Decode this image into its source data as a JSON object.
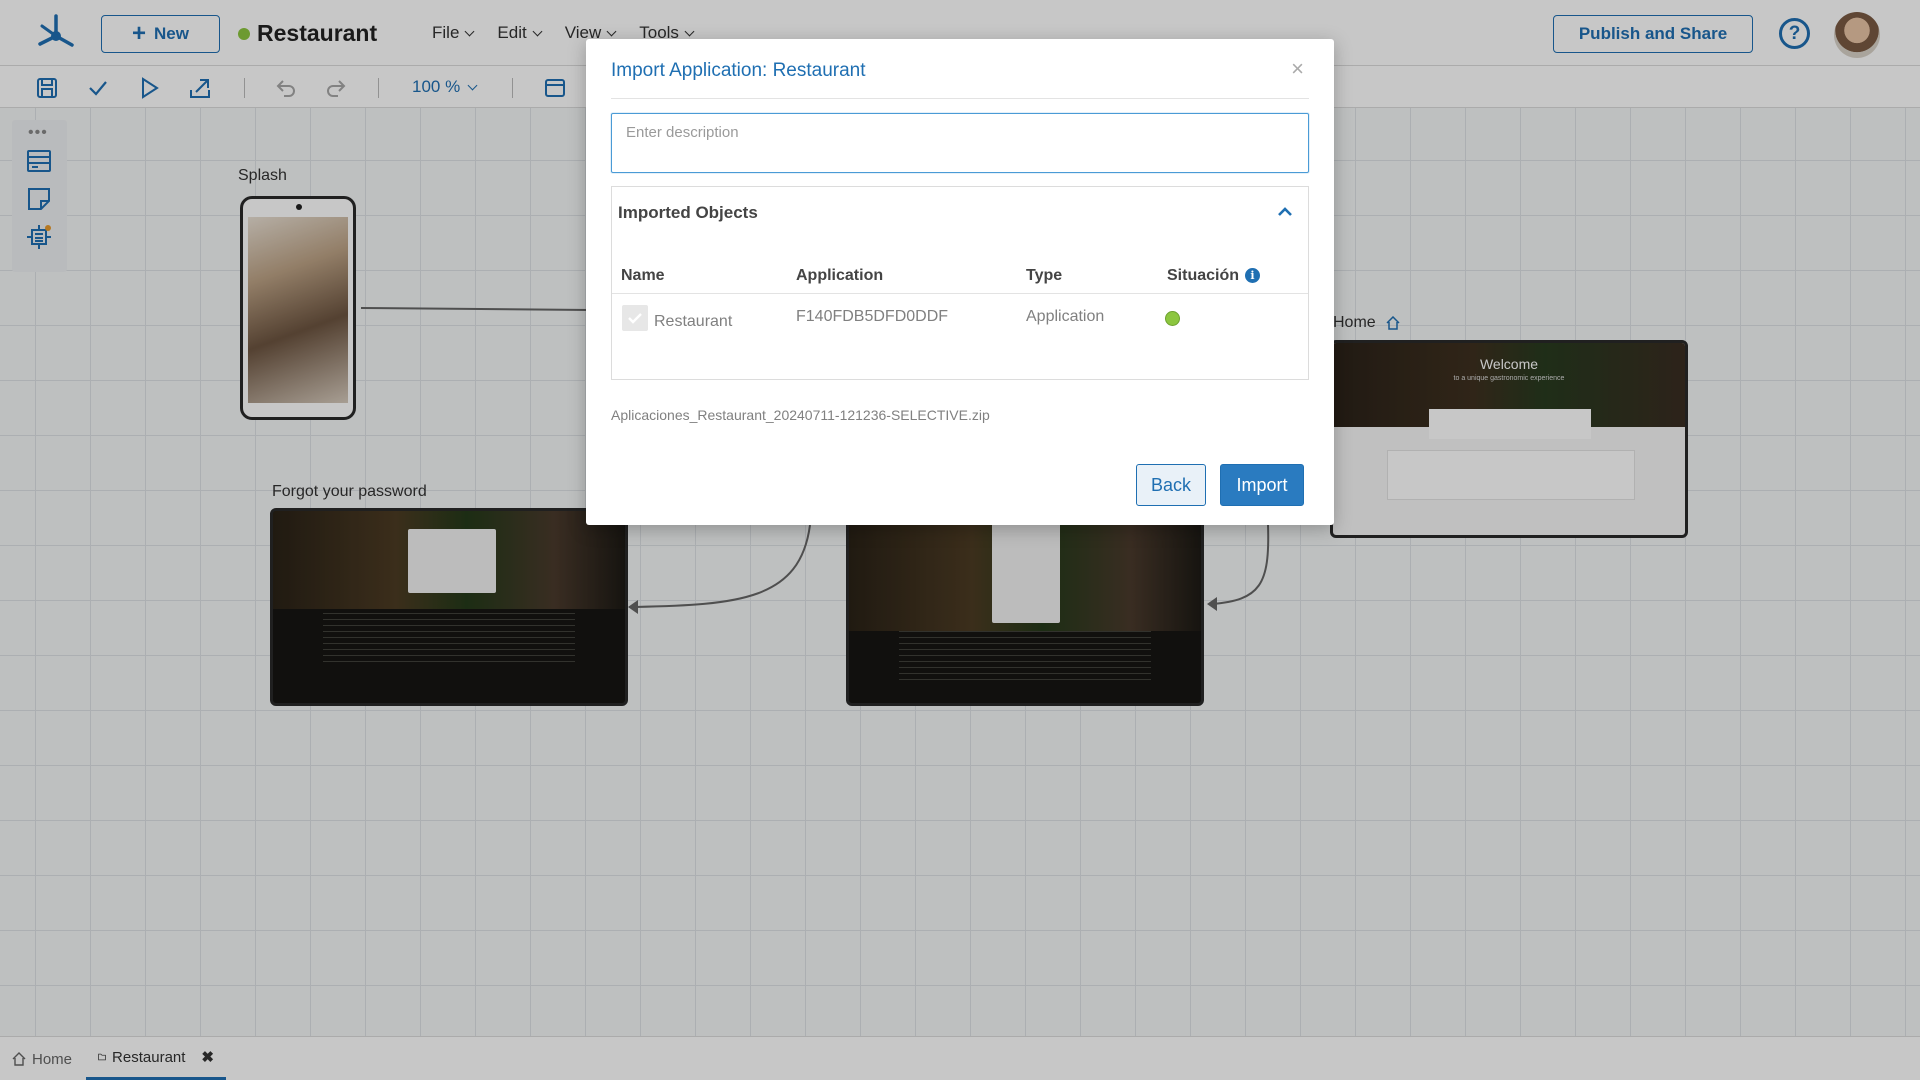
{
  "header": {
    "new_label": "New",
    "app_title": "Restaurant",
    "app_status_color": "#8cc63f",
    "menu": [
      {
        "label": "File"
      },
      {
        "label": "Edit"
      },
      {
        "label": "View"
      },
      {
        "label": "Tools"
      }
    ],
    "publish_label": "Publish and Share",
    "help_icon": "help-circle-icon"
  },
  "toolbar": {
    "icons": [
      "save-icon",
      "check-icon",
      "play-icon",
      "export-icon",
      "undo-icon",
      "redo-icon",
      "layout-icon"
    ],
    "zoom": "100 %"
  },
  "canvas": {
    "nodes": [
      {
        "label": "Splash"
      },
      {
        "label": "Forgot your password"
      },
      {
        "label": "Home"
      }
    ],
    "home_preview": {
      "welcome": "Welcome",
      "subtitle": "to a unique gastronomic experience"
    }
  },
  "dialog": {
    "title": "Import Application: Restaurant",
    "close": "×",
    "description_placeholder": "Enter description",
    "description_value": "",
    "panel_title": "Imported Objects",
    "columns": [
      "Name",
      "Application",
      "Type",
      "Situación"
    ],
    "rows": [
      {
        "name": "Restaurant",
        "application": "F140FDB5DFD0DDF",
        "type": "Application",
        "status_color": "#8cc63f"
      }
    ],
    "filename": "Aplicaciones_Restaurant_20240711-121236-SELECTIVE.zip",
    "back_label": "Back",
    "import_label": "Import"
  },
  "bottom_tabs": [
    {
      "label": "Home"
    },
    {
      "label": "Restaurant"
    }
  ],
  "colors": {
    "accent": "#1f6fb2",
    "primary_button": "#2a7bc0",
    "status_ok": "#8cc63f"
  }
}
